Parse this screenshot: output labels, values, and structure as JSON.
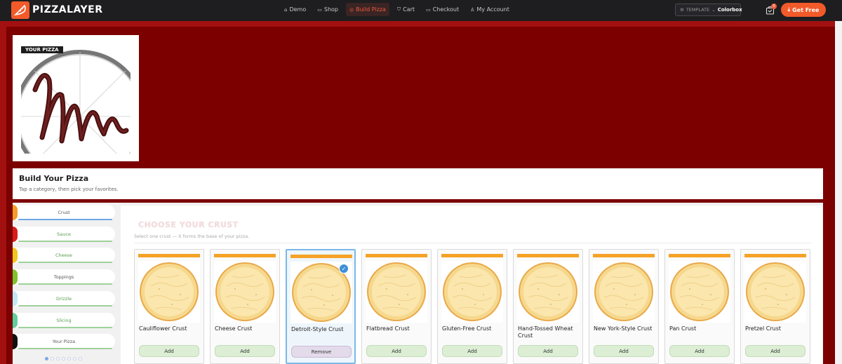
{
  "brand": {
    "name": "PIZZALAYER"
  },
  "nav": [
    {
      "label": "Demo",
      "icon": "home-icon",
      "active": false
    },
    {
      "label": "Shop",
      "icon": "shop-icon",
      "active": false
    },
    {
      "label": "Build Pizza",
      "icon": "target-icon",
      "active": true
    },
    {
      "label": "Cart",
      "icon": "cart-icon",
      "active": false
    },
    {
      "label": "Checkout",
      "icon": "card-icon",
      "active": false
    },
    {
      "label": "My Account",
      "icon": "user-icon",
      "active": false
    }
  ],
  "template": {
    "label": "TEMPLATE",
    "value": "Colorbox"
  },
  "cart": {
    "count": "0"
  },
  "cta": {
    "label": "Get Free"
  },
  "preview": {
    "label": "YOUR PIZZA"
  },
  "builder": {
    "title": "Build Your Pizza",
    "subtitle": "Tap a category, then pick your favorites."
  },
  "tabs": [
    {
      "label": "Crust",
      "dot": "#f39a2b",
      "underline": "#6ea6e8",
      "labelColor": "#555555"
    },
    {
      "label": "Sauce",
      "dot": "#d81c1c",
      "underline": "#9fd09a",
      "labelColor": "#5a9e4f"
    },
    {
      "label": "Cheese",
      "dot": "#f4c61c",
      "underline": "#9fd09a",
      "labelColor": "#5a9e4f"
    },
    {
      "label": "Toppings",
      "dot": "#7cc42a",
      "underline": "#9fd09a",
      "labelColor": "#555555"
    },
    {
      "label": "Drizzle",
      "dot": "#bfe8f4",
      "underline": "#9fd09a",
      "labelColor": "#5a9e4f"
    },
    {
      "label": "Slicing",
      "dot": "#5fcf9c",
      "underline": "#9fd09a",
      "labelColor": "#5a9e4f"
    },
    {
      "label": "Your Pizza",
      "dot": "#111111",
      "underline": "#9fd09a",
      "labelColor": "#555555"
    }
  ],
  "choose": {
    "title": "CHOOSE YOUR CRUST",
    "subtitle": "Select one crust — it forms the base of your pizza."
  },
  "crusts": [
    {
      "name": "Cauliflower Crust",
      "action": "Add",
      "selected": false
    },
    {
      "name": "Cheese Crust",
      "action": "Add",
      "selected": false
    },
    {
      "name": "Detroit-Style Crust",
      "action": "Remove",
      "selected": true
    },
    {
      "name": "Flatbread Crust",
      "action": "Add",
      "selected": false
    },
    {
      "name": "Gluten-Free Crust",
      "action": "Add",
      "selected": false
    },
    {
      "name": "Hand-Tossed Wheat Crust",
      "action": "Add",
      "selected": false
    },
    {
      "name": "New York-Style Crust",
      "action": "Add",
      "selected": false
    },
    {
      "name": "Pan Crust",
      "action": "Add",
      "selected": false
    },
    {
      "name": "Pretzel Crust",
      "action": "Add",
      "selected": false
    }
  ],
  "pager": {
    "total": 7,
    "active": 0
  }
}
